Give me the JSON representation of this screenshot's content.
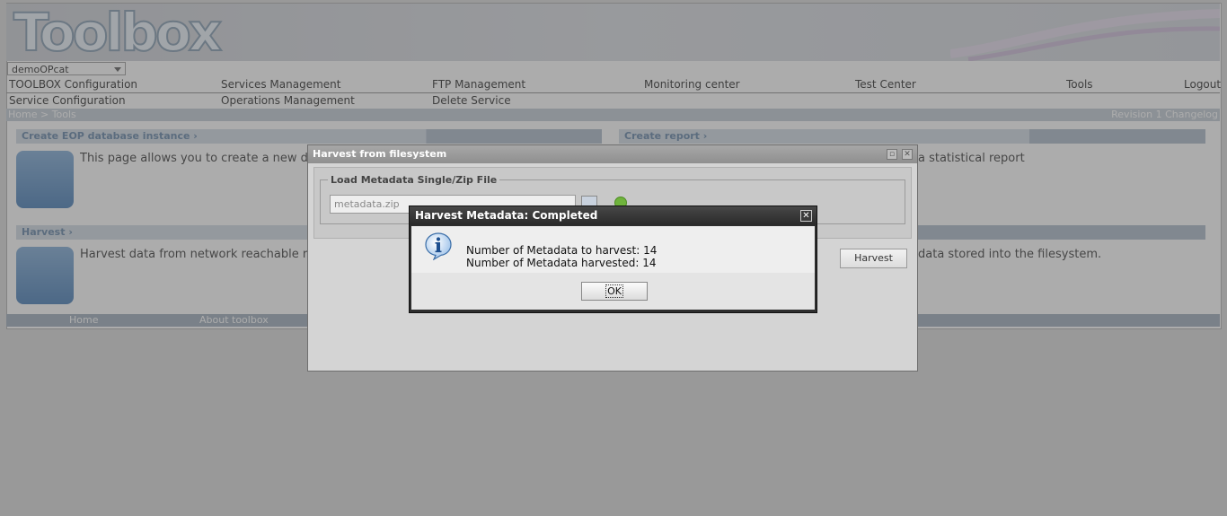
{
  "app": {
    "logo_text": "Toolbox",
    "category_select": "demoOPcat"
  },
  "menu": {
    "row1": [
      "TOOLBOX Configuration",
      "Services Management",
      "FTP Management",
      "Monitoring center",
      "Test Center",
      "Tools",
      "Logout"
    ],
    "row2": [
      "Service Configuration",
      "Operations Management",
      "Delete Service"
    ]
  },
  "breadcrumb": {
    "path": "Home > Tools",
    "revision": "Revision 1 Changelog"
  },
  "sections": {
    "create_eop": {
      "title": "Create EOP database instance ›",
      "text": "This page allows you to create a new da"
    },
    "create_report": {
      "title": "Create report ›",
      "text": "a statistical report"
    },
    "harvest": {
      "title": "Harvest ›",
      "text": "Harvest data from network reachable re"
    },
    "harvest_fs_text": "data stored into the filesystem."
  },
  "footer": {
    "home": "Home",
    "about": "About toolbox"
  },
  "fs_window": {
    "title": "Harvest from filesystem",
    "legend": "Load Metadata Single/Zip File",
    "file_value": "metadata.zip",
    "harvest_label": "Harvest"
  },
  "alert": {
    "title": "Harvest Metadata: Completed",
    "line1": "Number of Metadata to harvest: 14",
    "line2": "Number of Metadata harvested: 14",
    "ok_label": "OK"
  },
  "colors": {
    "alert_title_bg": "#2e2e2e",
    "overlay": "#5a5a5a",
    "accent_blue": "#5c7fa3"
  }
}
